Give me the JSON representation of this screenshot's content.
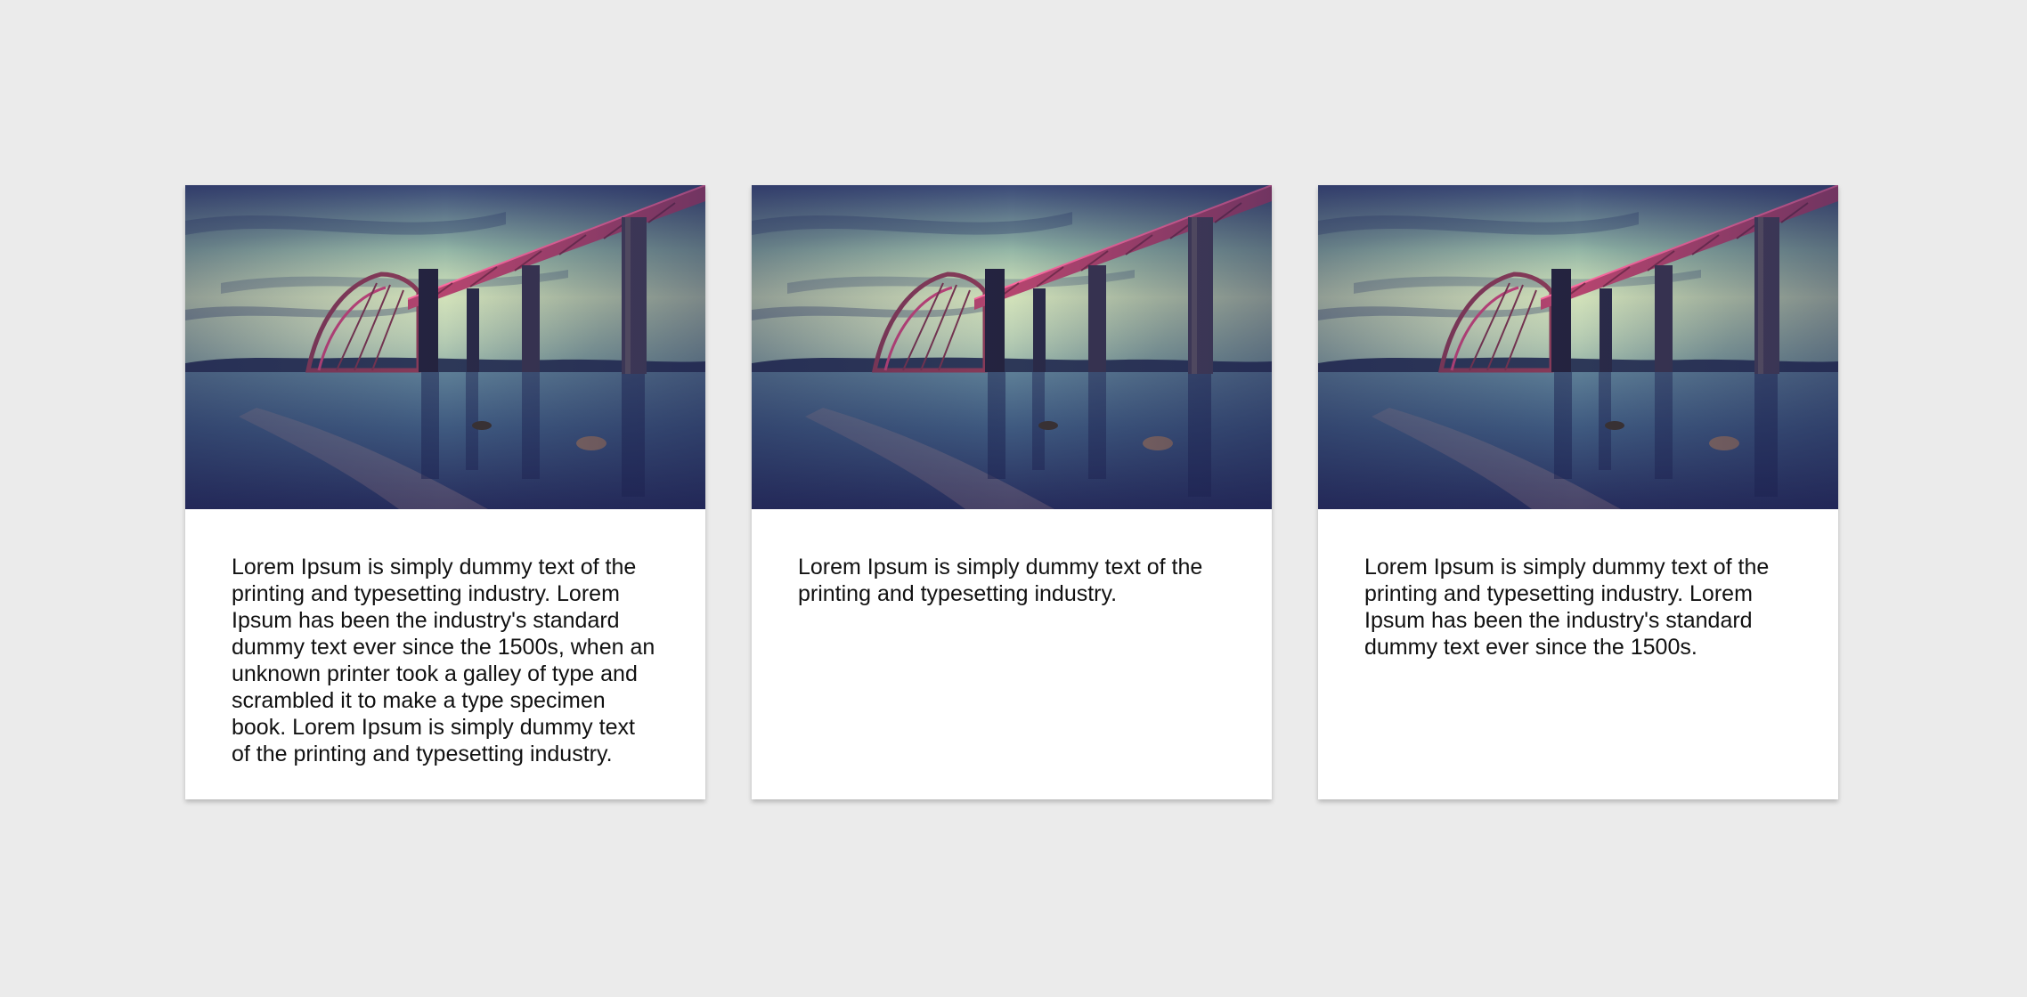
{
  "cards": [
    {
      "text": "Lorem Ipsum is simply dummy text of the printing and typesetting industry. Lorem Ipsum has been the industry's standard dummy text ever since the 1500s, when an unknown printer took a galley of type and scrambled it to make a type specimen book. Lorem Ipsum is simply dummy text of the printing and typesetting industry."
    },
    {
      "text": "Lorem Ipsum is simply dummy text of the printing and typesetting industry."
    },
    {
      "text": "Lorem Ipsum is simply dummy text of the printing and typesetting industry. Lorem Ipsum has been the industry's standard dummy text ever since the 1500s."
    }
  ]
}
